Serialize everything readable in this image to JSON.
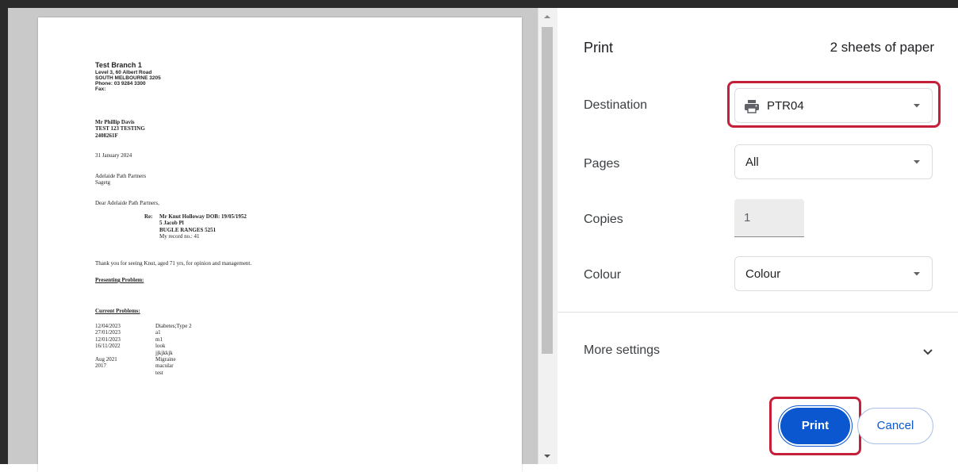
{
  "print_preview": {
    "letter": {
      "branch_name": "Test Branch 1",
      "address_line1": "Level 3, 60 Albert Road",
      "address_line2": "SOUTH MELBOURNE  3205",
      "phone": "Phone: 03 9284 3300",
      "fax": "Fax:",
      "patient_name": "Mr Phillip Davis",
      "patient_line2": "TEST 123 TESTING",
      "patient_id": "2408261F",
      "date": "31 January 2024",
      "recipient_org": "Adelaide Path Partners",
      "recipient_line2": "Sagetg",
      "salutation": "Dear Adelaide Path Partners,",
      "re_label": "Re:",
      "re_name_dob": "Mr Knut Holloway  DOB: 19/05/1952",
      "re_address1": "5 Jacob Pl",
      "re_address2": "BUGLE RANGES 5251",
      "re_record": "My record no.: 41",
      "body_text": "Thank you for seeing Knut, aged 71 yrs, for opinion and management.",
      "presenting_heading": "Presenting Problem:",
      "current_heading": "Current Problems:",
      "problems": [
        {
          "date": "12/04/2023",
          "desc": "Diabetes;Type 2"
        },
        {
          "date": "27/01/2023",
          "desc": "a1"
        },
        {
          "date": "12/01/2023",
          "desc": "m1"
        },
        {
          "date": "16/11/2022",
          "desc": "look"
        },
        {
          "date": "",
          "desc": "jjkjkkjk"
        },
        {
          "date": "Aug 2021",
          "desc": "Migraine"
        },
        {
          "date": "2017",
          "desc": "macular"
        },
        {
          "date": "",
          "desc": "test"
        }
      ]
    }
  },
  "print_panel": {
    "title": "Print",
    "sheets": "2 sheets of paper",
    "destination": {
      "label": "Destination",
      "value": "PTR04",
      "icon": "printer-icon"
    },
    "pages": {
      "label": "Pages",
      "value": "All"
    },
    "copies": {
      "label": "Copies",
      "value": "1"
    },
    "colour": {
      "label": "Colour",
      "value": "Colour"
    },
    "more_settings": "More settings",
    "print_button": "Print",
    "cancel_button": "Cancel",
    "colors": {
      "primary": "#0b57d0",
      "highlight": "#c61f3a"
    }
  }
}
